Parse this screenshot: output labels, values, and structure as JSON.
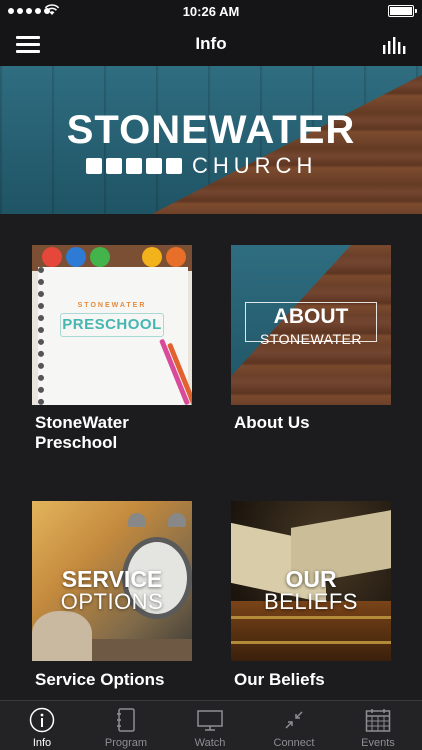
{
  "status_bar": {
    "time": "10:26 AM"
  },
  "navbar": {
    "title": "Info"
  },
  "banner": {
    "brand_primary": "STONEWATER",
    "brand_secondary": "CHURCH"
  },
  "tiles": [
    {
      "label": "StoneWater Preschool",
      "image_text_small": "STONEWATER",
      "image_text_big": "PRESCHOOL"
    },
    {
      "label": "About Us",
      "image_text_big": "ABOUT",
      "image_text_small": "STONEWATER"
    },
    {
      "label": "Service Options",
      "image_text_big": "SERVICE",
      "image_text_small": "OPTIONS"
    },
    {
      "label": "Our Beliefs",
      "image_text_big": "OUR",
      "image_text_small": "BELIEFS"
    }
  ],
  "tabbar": {
    "tabs": [
      {
        "label": "Info",
        "icon": "info-icon",
        "active": true
      },
      {
        "label": "Program",
        "icon": "notebook-icon",
        "active": false
      },
      {
        "label": "Watch",
        "icon": "monitor-icon",
        "active": false
      },
      {
        "label": "Connect",
        "icon": "arrows-inward-icon",
        "active": false
      },
      {
        "label": "Events",
        "icon": "calendar-icon",
        "active": false
      }
    ]
  },
  "colors": {
    "background": "#1c1c1e",
    "bar": "#151517",
    "tab_inactive": "#8e8e93",
    "teal": "#2f6d80",
    "wood": "#6e4229"
  }
}
